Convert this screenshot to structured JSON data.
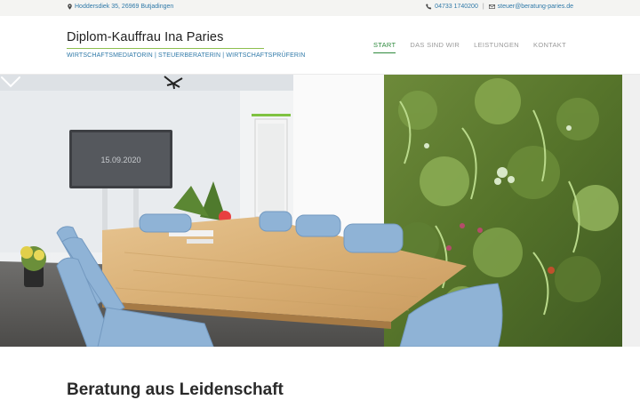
{
  "topbar": {
    "address": "Hoddersdiek 35, 26969 Butjadingen",
    "phone": "04733 1740200",
    "separator": "|",
    "email": "steuer@beratung-paries.de"
  },
  "brand": {
    "title": "Diplom-Kauffrau Ina Paries",
    "subtitle": "WIRTSCHAFTSMEDIATORIN | STEUERBERATERIN | WIRTSCHAFTSPRÜFERIN"
  },
  "nav": {
    "items": [
      {
        "label": "START",
        "active": true
      },
      {
        "label": "DAS SIND WIR",
        "active": false
      },
      {
        "label": "LEISTUNGEN",
        "active": false
      },
      {
        "label": "KONTAKT",
        "active": false
      }
    ]
  },
  "hero": {
    "tv_text": "15.09.2020",
    "scroll_icon": "chevron-down-icon"
  },
  "main": {
    "heading": "Beratung aus Leidenschaft"
  },
  "colors": {
    "link_blue": "#2f79a8",
    "accent_green": "#2f8a3e",
    "line_green": "#8dbf4e"
  }
}
